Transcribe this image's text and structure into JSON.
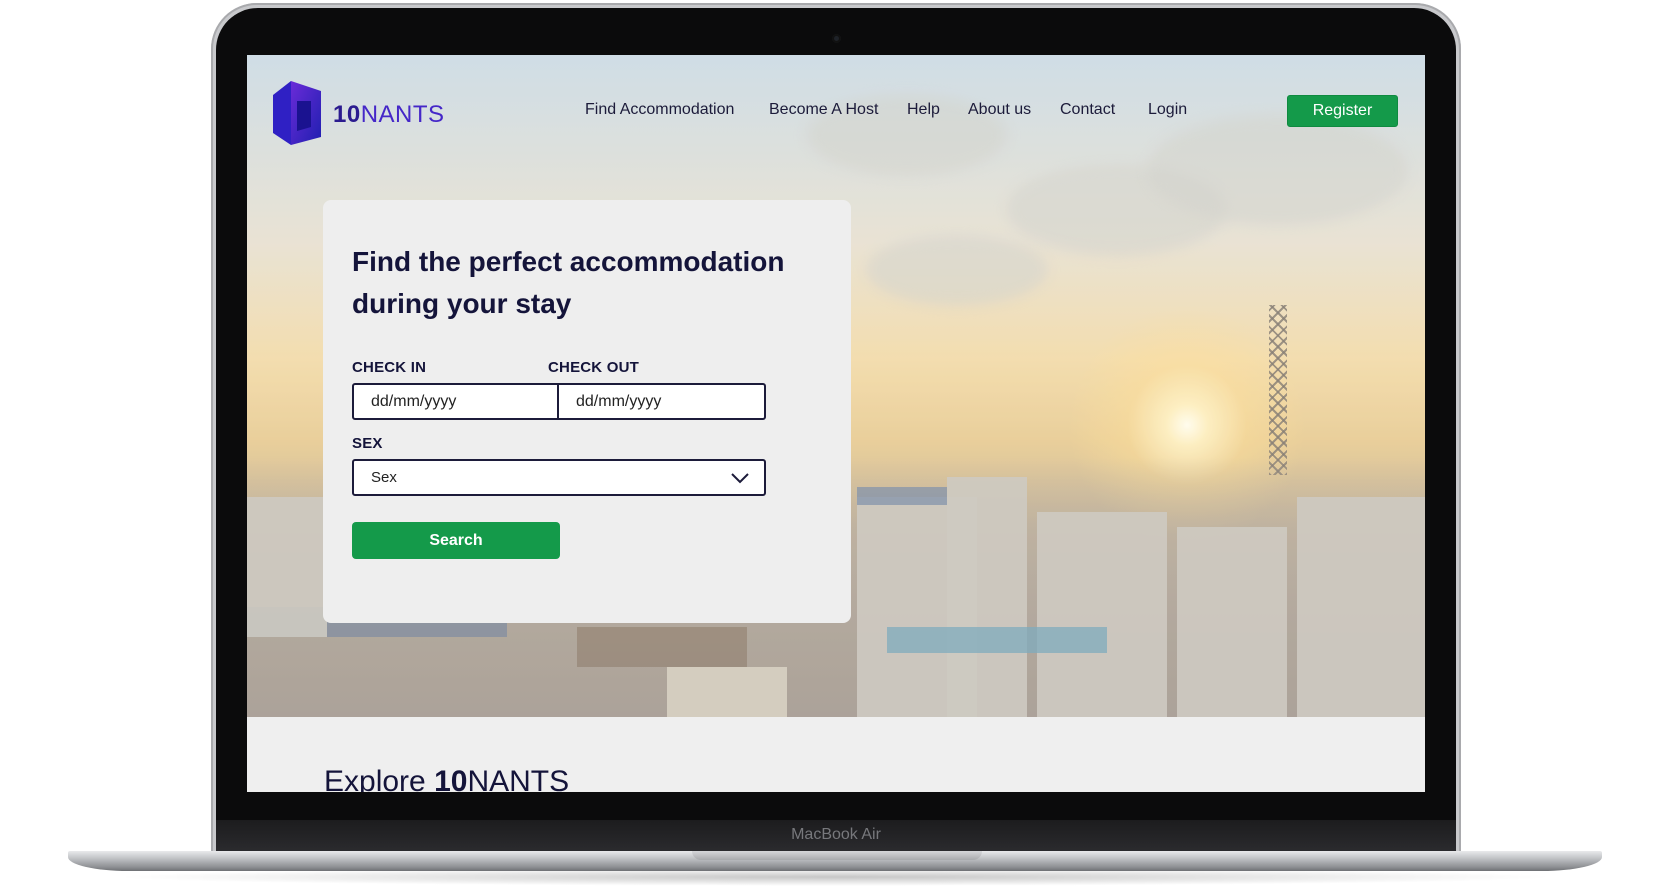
{
  "device": {
    "label": "MacBook Air"
  },
  "brand": {
    "logo_bold": "10",
    "logo_rest": "NANTS",
    "color": "#4527c8"
  },
  "nav": {
    "links": [
      "Find Accommodation",
      "Become A Host",
      "Help",
      "About us",
      "Contact",
      "Login"
    ],
    "register_label": "Register"
  },
  "search": {
    "title": "Find the perfect accommodation during your stay",
    "check_in_label": "CHECK IN",
    "check_in_value": "dd/mm/yyyy",
    "check_out_label": "CHECK OUT",
    "check_out_value": "dd/mm/yyyy",
    "sex_label": "SEX",
    "sex_selected": "Sex",
    "button_label": "Search"
  },
  "explore": {
    "prefix": "Explore ",
    "brand_bold": "10",
    "brand_rest": "NANTS"
  },
  "colors": {
    "accent_green": "#149a4a",
    "dark_text": "#14143a"
  }
}
